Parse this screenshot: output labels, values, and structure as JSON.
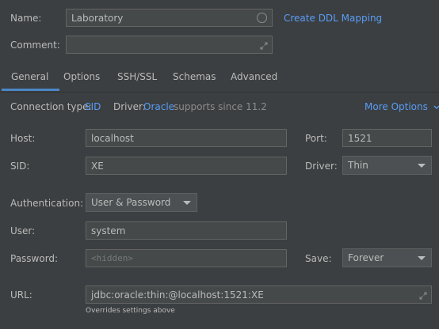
{
  "form": {
    "name_label": "Name:",
    "name_value": "Laboratory",
    "create_ddl_link": "Create DDL Mapping",
    "comment_label": "Comment:",
    "comment_value": ""
  },
  "tabs": [
    {
      "label": "General",
      "active": true
    },
    {
      "label": "Options",
      "active": false
    },
    {
      "label": "SSH/SSL",
      "active": false
    },
    {
      "label": "Schemas",
      "active": false
    },
    {
      "label": "Advanced",
      "active": false
    }
  ],
  "connection": {
    "type_label": "Connection type:",
    "type_value": "SID",
    "driver_label": "Driver:",
    "driver_value": "Oracle",
    "driver_note": "supports since 11.2",
    "more_options": "More Options"
  },
  "general": {
    "host_label": "Host:",
    "host_value": "localhost",
    "port_label": "Port:",
    "port_value": "1521",
    "sid_label": "SID:",
    "sid_value": "XE",
    "driver_label": "Driver:",
    "driver_select": "Thin",
    "auth_label": "Authentication:",
    "auth_select": "User & Password",
    "user_label": "User:",
    "user_value": "system",
    "password_label": "Password:",
    "password_placeholder": "<hidden>",
    "save_label": "Save:",
    "save_select": "Forever",
    "url_label": "URL:",
    "url_value": "jdbc:oracle:thin:@localhost:1521:XE",
    "url_note": "Overrides settings above"
  },
  "colors": {
    "background": "#3c3f41",
    "field_background": "#45494a",
    "link": "#589df6",
    "tab_underline": "#4a88c7"
  }
}
